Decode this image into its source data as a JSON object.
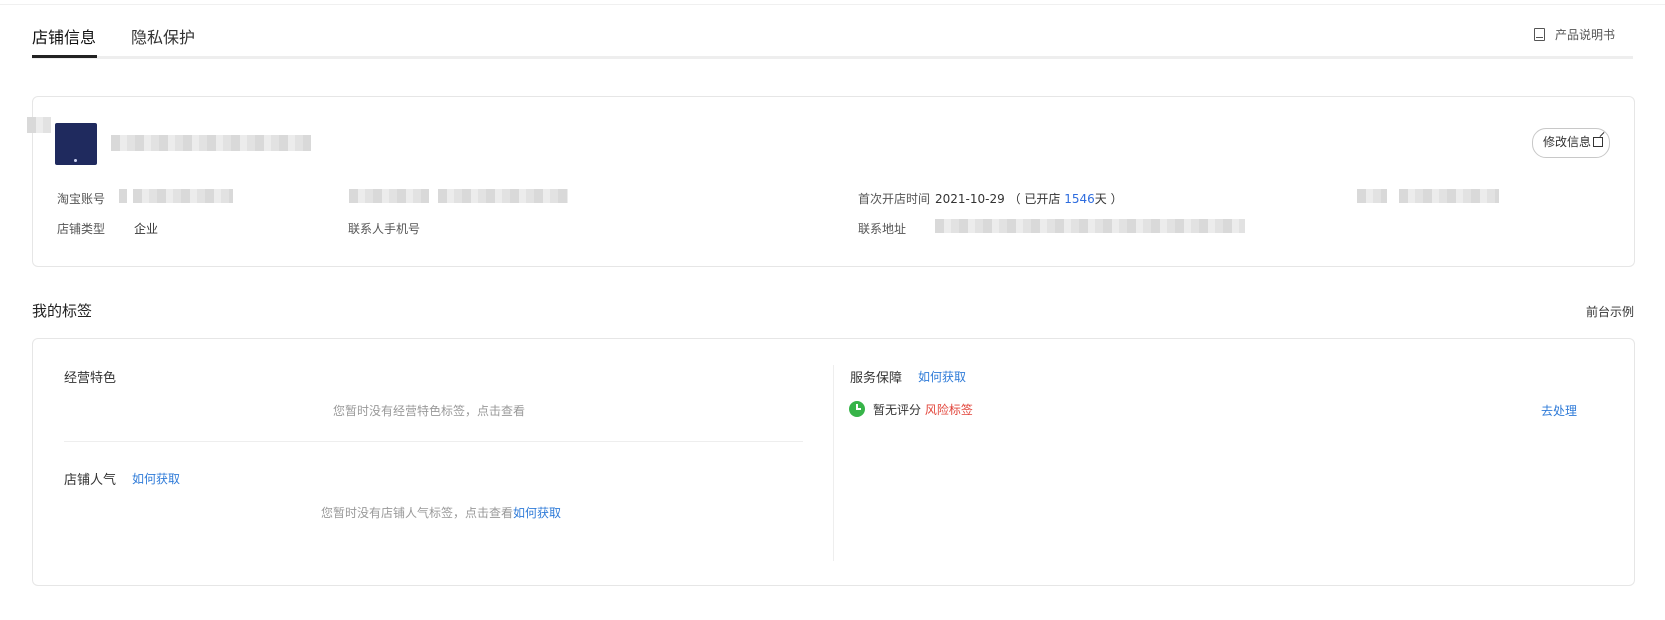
{
  "tabs": [
    {
      "label": "店铺信息",
      "active": true
    },
    {
      "label": "隐私保护",
      "active": false
    }
  ],
  "manual_label": "产品说明书",
  "store": {
    "edit_label": "修改信息",
    "fields": {
      "account_label": "淘宝账号",
      "first_open_label": "首次开店时间",
      "first_open_date": "2021-10-29",
      "open_prefix": "（ 已开店",
      "open_days": "1546",
      "open_suffix": "天 ）",
      "type_label": "店铺类型",
      "type_value": "企业",
      "phone_label": "联系人手机号",
      "address_label": "联系地址"
    }
  },
  "tags_section": {
    "title": "我的标签",
    "preview_label": "前台示例",
    "features": {
      "title": "经营特色",
      "empty_text": "您暂时没有经营特色标签，点击查看"
    },
    "popularity": {
      "title": "店铺人气",
      "how_label": "如何获取",
      "empty_text": "您暂时没有店铺人气标签，点击查看",
      "empty_link": "如何获取"
    },
    "service": {
      "title": "服务保障",
      "how_label": "如何获取",
      "status_text": "暂无评分",
      "risk_label": "风险标签",
      "action_label": "去处理",
      "status_color": "#37b449",
      "risk_color": "#e2443a"
    }
  },
  "colors": {
    "link": "#2f7bd8",
    "accent_ink": "#222222"
  }
}
